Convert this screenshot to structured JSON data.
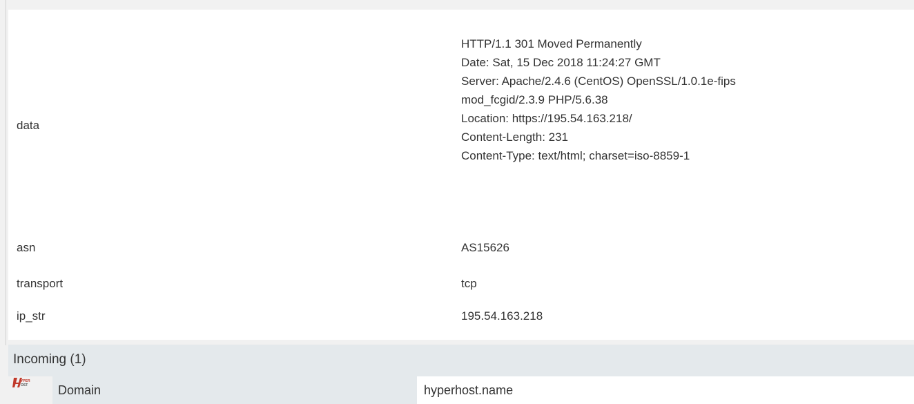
{
  "record": {
    "data_key": "data",
    "data_lines": [
      "HTTP/1.1 301 Moved Permanently",
      "Date: Sat, 15 Dec 2018 11:24:27 GMT",
      "Server: Apache/2.4.6 (CentOS) OpenSSL/1.0.1e-fips",
      "mod_fcgid/2.3.9 PHP/5.6.38",
      "Location: https://195.54.163.218/",
      "Content-Length: 231",
      "Content-Type: text/html; charset=iso-8859-1"
    ],
    "asn_key": "asn",
    "asn_value": "AS15626",
    "transport_key": "transport",
    "transport_value": "tcp",
    "ip_key": "ip_str",
    "ip_value": "195.54.163.218"
  },
  "incoming": {
    "title": "Incoming (1)",
    "logo_text": "HYPER HOST",
    "row": {
      "key": "Domain",
      "value": "hyperhost.name"
    }
  },
  "colors": {
    "page_bg": "#f1f1f1",
    "panel_bg": "#ffffff",
    "header_bg": "#e4e9ec",
    "logo_red": "#c0392b"
  }
}
